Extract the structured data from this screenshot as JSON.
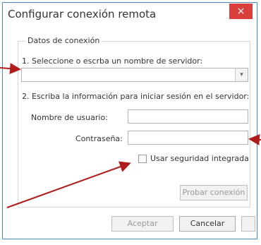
{
  "dialog": {
    "title": "Configurar conexión remota",
    "close_glyph": "×"
  },
  "group": {
    "legend": "Datos de conexión",
    "step1_label": "1. Seleccione o escrba un nombre de servidor:",
    "server_value": "",
    "combo_arrow_glyph": "▾",
    "step2_label": "2. Escriba la información para iniciar sesión en el servidor:",
    "username_label": "Nombre de usuario:",
    "username_value": "",
    "password_label": "Contraseña:",
    "password_value": "",
    "integrated_label": "Usar seguridad integrada",
    "integrated_checked": false,
    "test_button": "Probar conexión"
  },
  "footer": {
    "accept_button": "Aceptar",
    "cancel_button": "Cancelar",
    "third_button": ""
  },
  "annotation": {
    "arrow_color": "#b01c1c"
  }
}
